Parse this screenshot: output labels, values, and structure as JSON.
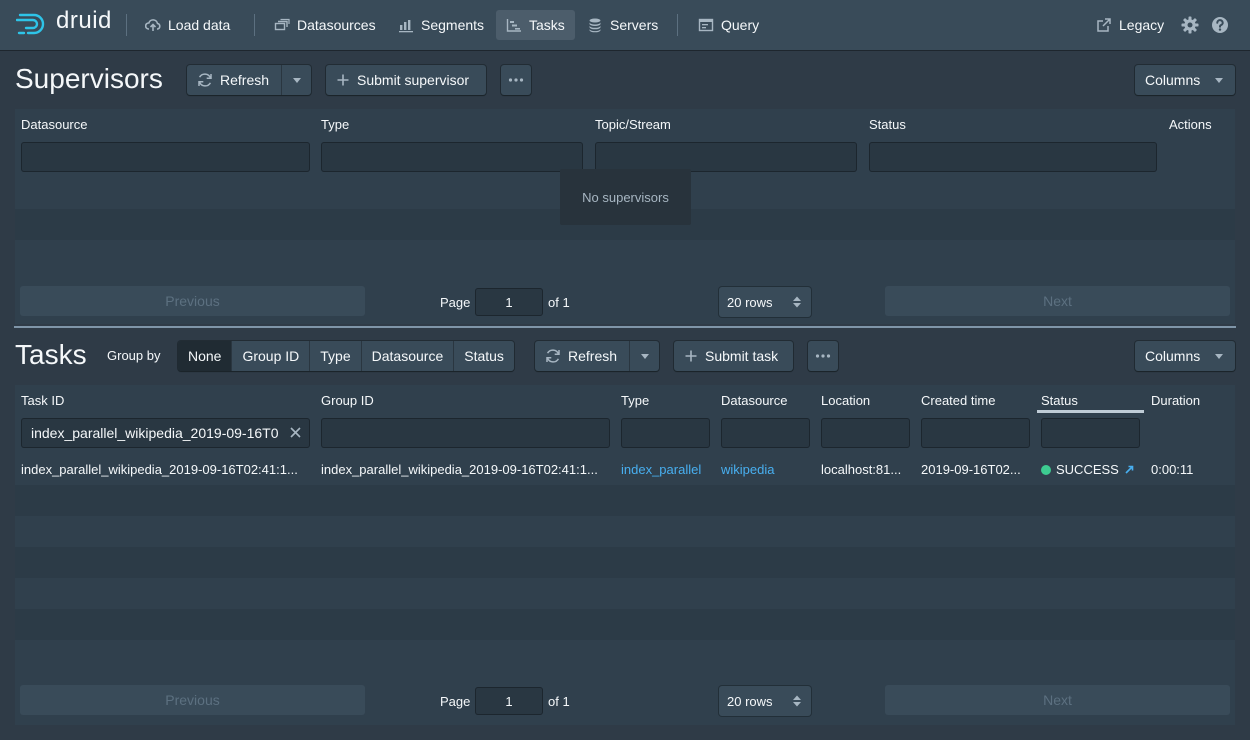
{
  "nav": {
    "brand": "druid",
    "items": [
      {
        "label": "Load data",
        "icon": "cloud-upload-icon"
      },
      {
        "label": "Datasources",
        "icon": "multi-select-icon"
      },
      {
        "label": "Segments",
        "icon": "stacked-chart-icon"
      },
      {
        "label": "Tasks",
        "icon": "gantt-chart-icon",
        "active": true
      },
      {
        "label": "Servers",
        "icon": "database-icon"
      },
      {
        "label": "Query",
        "icon": "application-icon"
      }
    ],
    "legacy_label": "Legacy"
  },
  "supervisors": {
    "title": "Supervisors",
    "refresh_label": "Refresh",
    "submit_label": "Submit supervisor",
    "columns_label": "Columns",
    "headers": [
      "Datasource",
      "Type",
      "Topic/Stream",
      "Status",
      "Actions"
    ],
    "empty_text": "No supervisors",
    "pager": {
      "previous": "Previous",
      "next": "Next",
      "page_label": "Page",
      "page_value": "1",
      "of_label": "of 1",
      "rows_label": "20 rows"
    }
  },
  "tasks": {
    "title": "Tasks",
    "group_by_label": "Group by",
    "group_options": [
      "None",
      "Group ID",
      "Type",
      "Datasource",
      "Status"
    ],
    "active_group": "None",
    "refresh_label": "Refresh",
    "submit_label": "Submit task",
    "columns_label": "Columns",
    "headers": [
      "Task ID",
      "Group ID",
      "Type",
      "Datasource",
      "Location",
      "Created time",
      "Status",
      "Duration"
    ],
    "task_id_filter": "index_parallel_wikipedia_2019-09-16T0",
    "rows": [
      {
        "task_id": "index_parallel_wikipedia_2019-09-16T02:41:1...",
        "group_id": "index_parallel_wikipedia_2019-09-16T02:41:1...",
        "type": "index_parallel",
        "datasource": "wikipedia",
        "location": "localhost:81...",
        "created_time": "2019-09-16T02...",
        "status": "SUCCESS",
        "duration": "0:00:11"
      }
    ],
    "pager": {
      "previous": "Previous",
      "next": "Next",
      "page_label": "Page",
      "page_value": "1",
      "of_label": "of 1",
      "rows_label": "20 rows"
    }
  },
  "colors": {
    "success": "#3dcc91",
    "link": "#48aff0",
    "brand": "#2ec4e8"
  }
}
